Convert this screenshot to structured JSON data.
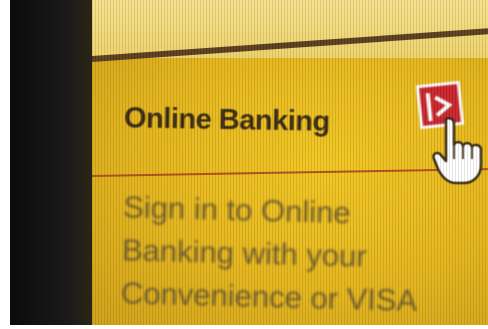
{
  "panel": {
    "title": "Online Banking",
    "body_lines": [
      "Sign in to Online",
      "Banking with your",
      "Convenience or VISA"
    ]
  },
  "icons": {
    "button": "arrow-right-icon",
    "cursor": "hand-pointer-icon"
  },
  "colors": {
    "screen": "#e4b51a",
    "accent": "#c8232a",
    "title_text": "#3a2a10"
  }
}
